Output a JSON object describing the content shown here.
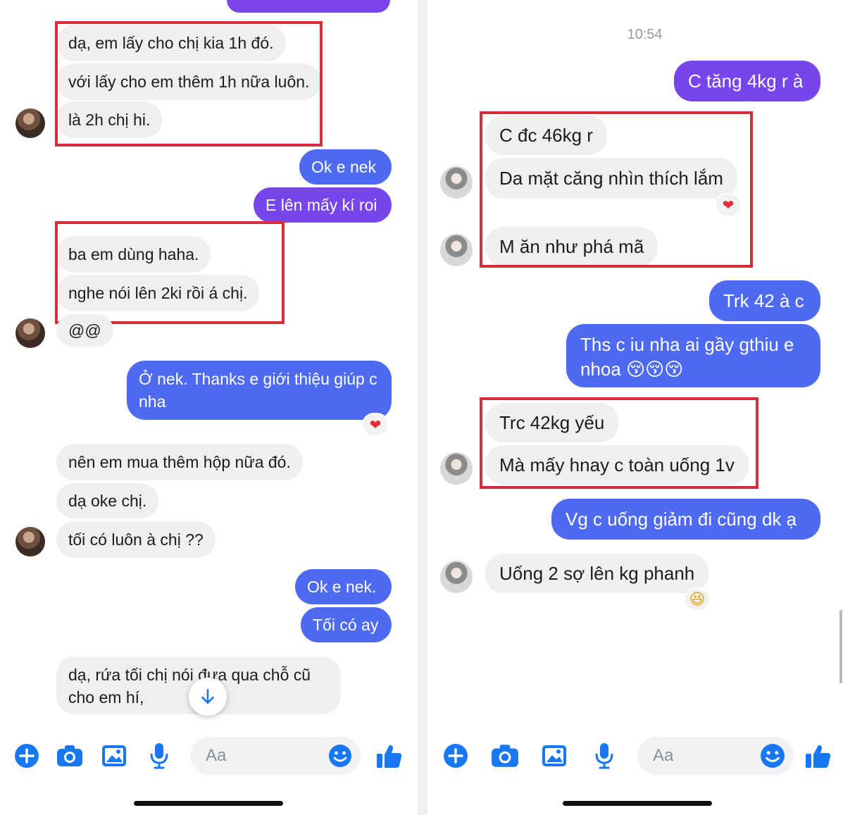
{
  "left": {
    "messages": [
      {
        "text": "dạ, em lấy cho chị kia 1h đó."
      },
      {
        "text": "với lấy cho em thêm 1h nữa luôn."
      },
      {
        "text": "là 2h chị hi."
      },
      {
        "text": "Ok e nek"
      },
      {
        "text": "E lên mấy kí roi"
      },
      {
        "text": "ba em dùng haha."
      },
      {
        "text": "nghe nói lên 2ki rồi á chị."
      },
      {
        "text": "@@"
      },
      {
        "text": "Ở nek. Thanks e giới thiệu giúp c nha"
      },
      {
        "text": "nên em mua thêm hộp nữa đó."
      },
      {
        "text": "dạ oke chị."
      },
      {
        "text": "tối có luôn à chị ??"
      },
      {
        "text": "Ok e nek."
      },
      {
        "text": "Tối có ay"
      },
      {
        "text": "dạ, rứa tối chị nói đưa qua chỗ cũ cho em hí,"
      }
    ],
    "composer_placeholder": "Aa"
  },
  "right": {
    "timestamp": "10:54",
    "messages": [
      {
        "text": "C tăng 4kg r à"
      },
      {
        "text": "C đc 46kg r"
      },
      {
        "text": "Da mặt căng nhìn thích lắm"
      },
      {
        "text": "M ăn như phá mã"
      },
      {
        "text": "Trk 42 à c"
      },
      {
        "text": "Ths c iu nha ai gầy gthiu e nhoa 😚😚😚"
      },
      {
        "text": "Trc 42kg yếu"
      },
      {
        "text": "Mà mấy hnay c toàn uống 1v"
      },
      {
        "text": "Vg c uống giảm đi cũng dk ạ"
      },
      {
        "text": "Uống 2 sợ lên kg phanh"
      }
    ],
    "composer_placeholder": "Aa"
  },
  "reactions": {
    "heart": "❤",
    "laugh": "😆"
  },
  "icons": [
    "plus-icon",
    "camera-icon",
    "image-icon",
    "microphone-icon",
    "emoji-icon",
    "thumbs-up-icon",
    "arrow-down-icon"
  ],
  "colors": {
    "outgoing_blue": "#4e6af0",
    "outgoing_purple": "#7646ec",
    "incoming": "#efefef",
    "highlight": "#d82c3b",
    "messenger_blue": "#1877f2"
  }
}
